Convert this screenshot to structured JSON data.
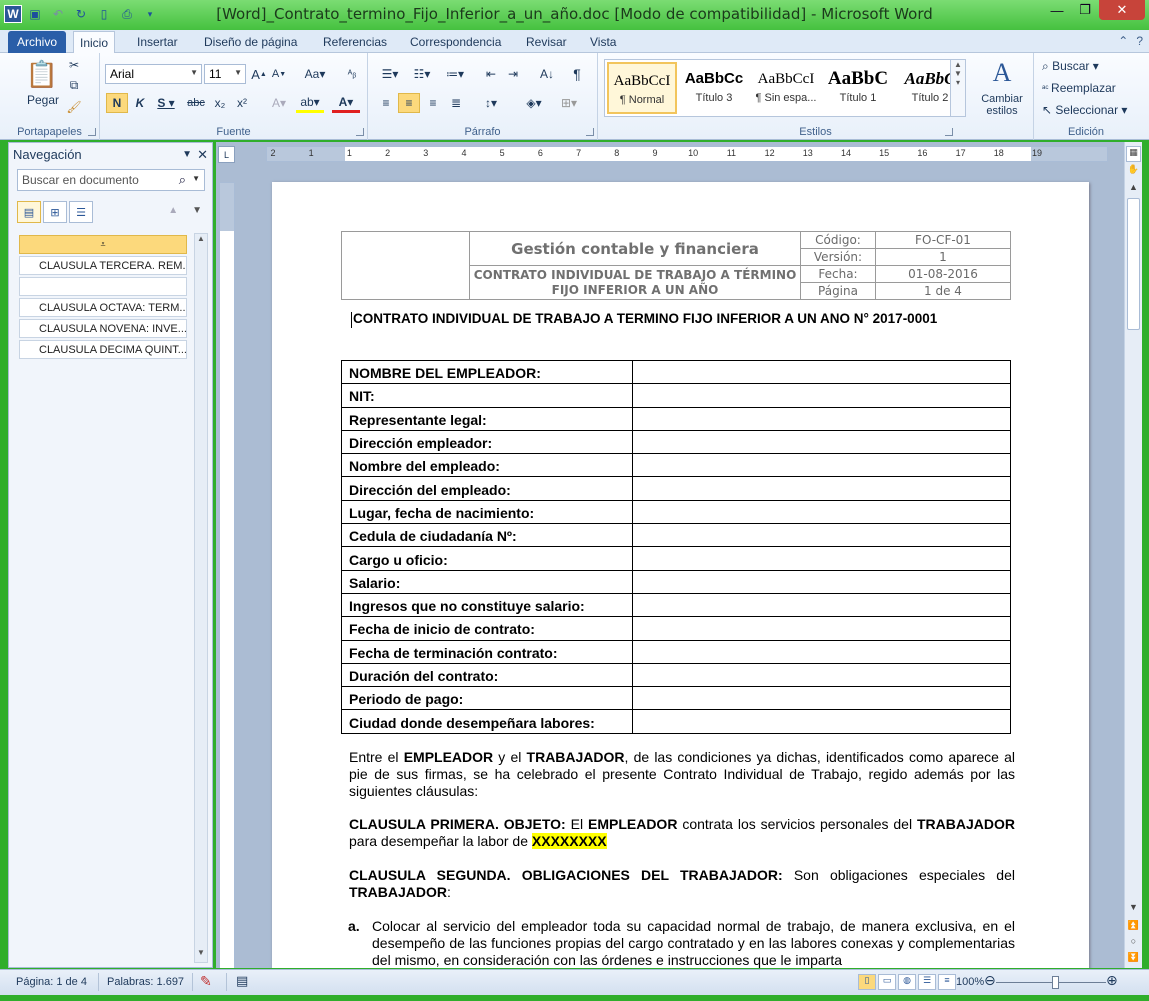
{
  "window": {
    "title": "[Word]_Contrato_termino_Fijo_Inferior_a_un_año.doc [Modo de compatibilidad]  -  Microsoft Word",
    "app_icon_letter": "W"
  },
  "tabs": {
    "file": "Archivo",
    "items": [
      "Inicio",
      "Insertar",
      "Diseño de página",
      "Referencias",
      "Correspondencia",
      "Revisar",
      "Vista"
    ]
  },
  "ribbon": {
    "clipboard": {
      "label": "Portapapeles",
      "paste": "Pegar"
    },
    "font": {
      "label": "Fuente",
      "name": "Arial",
      "size": "11",
      "bold": "N",
      "italic": "K",
      "subscript_label": "x₂",
      "superscript_label": "x²",
      "strike": "abc"
    },
    "paragraph": {
      "label": "Párrafo"
    },
    "styles": {
      "label": "Estilos",
      "items": [
        {
          "sample": "AaBbCcI",
          "name": "¶ Normal"
        },
        {
          "sample": "AaBbCc",
          "name": "Título 3"
        },
        {
          "sample": "AaBbCcI",
          "name": "¶ Sin espa..."
        },
        {
          "sample": "AaBbC",
          "name": "Título 1"
        },
        {
          "sample": "AaBbC",
          "name": "Título 2"
        }
      ],
      "change": "Cambiar estilos"
    },
    "editing": {
      "label": "Edición",
      "find": "Buscar",
      "replace": "Reemplazar",
      "select": "Seleccionar"
    }
  },
  "nav": {
    "title": "Navegación",
    "search_placeholder": "Buscar en documento",
    "items": [
      "CLAUSULA TERCERA. REM...",
      "",
      "CLAUSULA OCTAVA: TERM...",
      "CLAUSULA NOVENA: INVE...",
      "CLAUSULA DECIMA QUINT..."
    ]
  },
  "ruler": {
    "numbers": [
      "2",
      "1",
      "1",
      "2",
      "3",
      "4",
      "5",
      "6",
      "7",
      "8",
      "9",
      "10",
      "11",
      "12",
      "13",
      "14",
      "15",
      "16",
      "17",
      "18",
      "19"
    ]
  },
  "doc": {
    "header": {
      "company": "Gestión contable y financiera",
      "doc_name": "CONTRATO INDIVIDUAL DE TRABAJO A TÉRMINO FIJO INFERIOR A UN AÑO",
      "fields": [
        {
          "label": "Código:",
          "value": "FO-CF-01"
        },
        {
          "label": "Versión:",
          "value": "1"
        },
        {
          "label": "Fecha:",
          "value": "01-08-2016"
        },
        {
          "label": "Página",
          "value": "1 de 4"
        }
      ]
    },
    "title": "CONTRATO INDIVIDUAL DE TRABAJO A TERMINO FIJO INFERIOR A UN ANO N° 2017-0001",
    "rows": [
      "NOMBRE DEL EMPLEADOR:",
      "NIT:",
      "Representante legal:",
      "Dirección empleador:",
      "Nombre del empleado:",
      "Dirección del empleado:",
      "Lugar, fecha de nacimiento:",
      "Cedula de ciudadanía Nº:",
      "Cargo u oficio:",
      " Salario:",
      "Ingresos que no constituye salario:",
      "Fecha de inicio de contrato:",
      "Fecha de terminación contrato:",
      "Duración del contrato:",
      "Periodo de pago:",
      "Ciudad donde desempeñara labores:"
    ],
    "intro": {
      "t1": "Entre  el ",
      "b1": "EMPLEADOR",
      "t2": " y el ",
      "b2": "TRABAJADOR",
      "t3": ", de las condiciones ya dichas, identificados como aparece al pie de sus firmas, se ha celebrado el presente Contrato Individual de Trabajo, regido además por las siguientes  cláusulas:"
    },
    "clause1": {
      "b1": "CLAUSULA  PRIMERA.  OBJETO:",
      "t1": " El  ",
      "b2": "EMPLEADOR",
      "t2": "  contrata  los servicios personales  del ",
      "b3": "TRABAJADOR",
      "t3": " para desempeñar la labor de ",
      "hl": "XXXXXXXX"
    },
    "clause2": {
      "b1": "CLAUSULA  SEGUNDA.  OBLIGACIONES  DEL  TRABAJADOR:",
      "t1": " Son obligaciones especiales del ",
      "b2": "TRABAJADOR",
      "t2": ":"
    },
    "item_a": {
      "label": "a.",
      "text": "Colocar al servicio del empleador toda su capacidad normal de trabajo, de manera exclusiva, en el desempeño de las funciones propias del cargo contratado y en las labores conexas y complementarias del mismo, en consideración con las órdenes e instrucciones que le imparta"
    }
  },
  "status": {
    "page": "Página: 1 de 4",
    "words": "Palabras: 1.697",
    "zoom": "100%"
  }
}
